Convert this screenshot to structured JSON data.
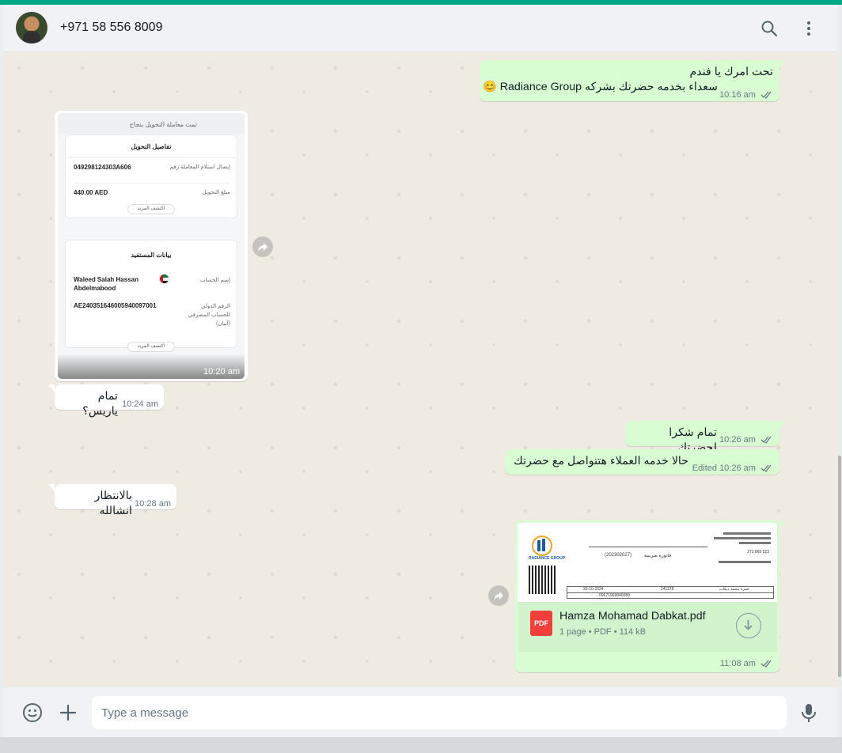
{
  "header": {
    "contact_name": "+971 58 556 8009",
    "icons": [
      "search-icon",
      "menu-icon"
    ]
  },
  "messages": [
    {
      "id": "m1",
      "direction": "out",
      "lines": [
        "تحت امرك يا فندم",
        "سعداء بخدمه حضرتك بشركه Radiance Group 😊"
      ],
      "time": "10:16 am",
      "status": "read"
    },
    {
      "id": "m2",
      "direction": "in",
      "type": "image",
      "time": "10:20 am",
      "receipt": {
        "success_text": "تمت معاملة التحويل بنجاح",
        "transfer_title": "تفاصيل التحويل",
        "receipt_label": "إيصال استلام المعاملة رقم",
        "receipt_value": "049298124303A606",
        "amount_label": "مبلغ التحويل",
        "amount_value": "440.00 AED",
        "more_label": "اكتشف المزيد",
        "beneficiary_title": "بيانات المستفيد",
        "account_name_label": "إسم الحساب",
        "account_name_value": "Waleed Salah Hassan Abdelmabood",
        "iban_label": "الرقم الدولي للحساب المصرفي (آيبان)",
        "iban_value": "AE240351646005940097001"
      }
    },
    {
      "id": "m3",
      "direction": "in",
      "text": "تمام ياريس؟",
      "time": "10:24 am"
    },
    {
      "id": "m4",
      "direction": "out",
      "text": "تمام شكرا لحضرتك",
      "time": "10:26 am",
      "status": "read"
    },
    {
      "id": "m5",
      "direction": "out",
      "text": "حالا خدمه العملاء هتتواصل مع حضرتك",
      "edited_label": "Edited",
      "time": "10:26 am",
      "status": "read"
    },
    {
      "id": "m6",
      "direction": "in",
      "text": "بالانتظار انشالله",
      "time": "10:28 am"
    },
    {
      "id": "m7",
      "direction": "out",
      "type": "document",
      "time": "11:08 am",
      "status": "read",
      "document": {
        "file_name": "Hamza Mohamad Dabkat.pdf",
        "file_badge": "PDF",
        "pages": "1 page",
        "file_type": "PDF",
        "file_size": "114 kB",
        "preview_logo_text": "RADIANCE GROUP",
        "preview_invoice_number": "(202302027)",
        "preview_invoice_title": "فاتورة ضريبية",
        "preview_phone": "273 865 523",
        "preview_date": "29-10-2024",
        "preview_reg_no": "241178",
        "preview_id_no": "00671969840089",
        "preview_student_name": "حمزة محمد دبكات"
      }
    }
  ],
  "composer": {
    "placeholder": "Type a message",
    "value": ""
  },
  "colors": {
    "accent": "#00a884",
    "outgoing_bubble": "#d9fdd3",
    "incoming_bubble": "#ffffff",
    "chat_background": "#efeae2",
    "read_ticks": "#53bdeb"
  }
}
